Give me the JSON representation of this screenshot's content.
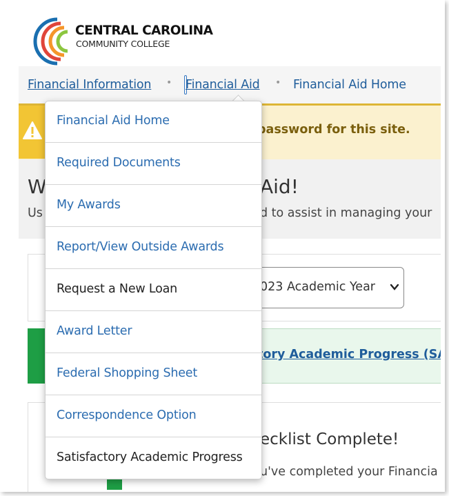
{
  "logo": {
    "name": "CENTRAL CAROLINA",
    "sub": "COMMUNITY COLLEGE"
  },
  "breadcrumb": {
    "items": [
      "Financial Information",
      "Financial Aid",
      "Financial Aid Home"
    ],
    "separator": "•"
  },
  "alert": {
    "visible_text": "password for this site."
  },
  "welcome": {
    "title_left": "W",
    "title_right": "Aid!",
    "sub_left": "Us",
    "sub_right": "d to assist in managing your"
  },
  "year_select": {
    "visible_value": "023 Academic Year"
  },
  "sap_banner": {
    "visible_text": "tory Academic Progress (SAP"
  },
  "checklist": {
    "title_visible": "ecklist Complete!",
    "sub_visible": "u've completed your Financia"
  },
  "dropdown": {
    "items": [
      "Financial Aid Home",
      "Required Documents",
      "My Awards",
      "Report/View Outside Awards",
      "Request a New Loan",
      "Award Letter",
      "Federal Shopping Sheet",
      "Correspondence Option",
      "Satisfactory Academic Progress"
    ]
  },
  "colors": {
    "link": "#2b6cb0",
    "alert_bg": "#fbf1cf",
    "alert_icon": "#f2c534",
    "success": "#1e9e45",
    "brand_orange": "#f5962a",
    "brand_green": "#8cc63f",
    "brand_red": "#e0453a",
    "brand_blue": "#1a6fb0"
  },
  "icons": {
    "warning": "warning-icon",
    "chevron": "chevron-down-icon"
  }
}
